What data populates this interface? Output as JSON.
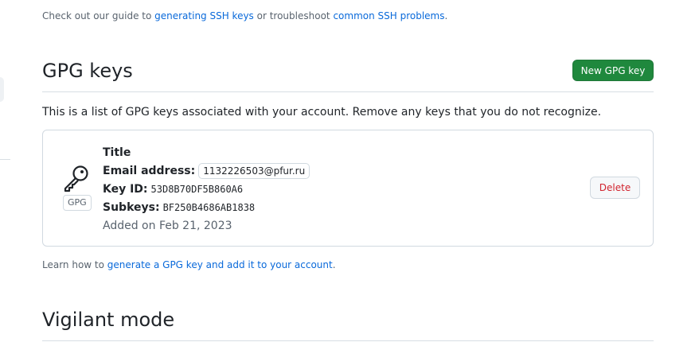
{
  "ssh_help": {
    "prefix": "Check out our guide to ",
    "guide_link": "generating SSH keys",
    "middle": " or troubleshoot ",
    "problems_link": "common SSH problems",
    "suffix": "."
  },
  "gpg_section": {
    "title": "GPG keys",
    "new_button": "New GPG key",
    "intro": "This is a list of GPG keys associated with your account. Remove any keys that you do not recognize.",
    "key": {
      "icon": "key-icon",
      "badge": "GPG",
      "title": "Title",
      "email_label": "Email address:",
      "email_value": "1132226503@pfur.ru",
      "keyid_label": "Key ID:",
      "keyid_value": "53D8B70DF5B860A6",
      "subkeys_label": "Subkeys:",
      "subkeys_value": "BF250B4686AB1838",
      "added": "Added on Feb 21, 2023",
      "delete_button": "Delete"
    },
    "learn_prefix": "Learn how to ",
    "learn_link": "generate a GPG key and add it to your account",
    "learn_suffix": "."
  },
  "vigilant_section": {
    "title": "Vigilant mode"
  },
  "colors": {
    "primary_button": "#1f883d",
    "link": "#0969da",
    "danger": "#d1242f",
    "muted": "#59636e",
    "border": "#d1d9e0"
  }
}
